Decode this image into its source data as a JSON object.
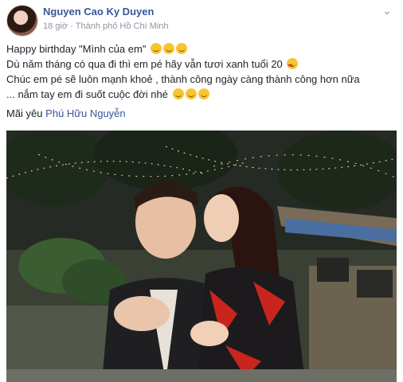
{
  "post": {
    "author": "Nguyen Cao Ky Duyen",
    "time": "18 giờ",
    "separator": "·",
    "location": "Thành phố Hồ Chí Minh",
    "more_icon": "more-options-icon",
    "lines": [
      {
        "text": "Happy birthday \"Mình của em\"",
        "emoji": [
          "grin-icon",
          "grin-icon",
          "grin-icon"
        ]
      },
      {
        "text": "Dù năm tháng có qua đi thì em pé hãy vẫn tươi xanh tuổi 20",
        "emoji": [
          "heart-eyes-icon"
        ]
      },
      {
        "text": "Chúc em pé sẽ luôn mạnh khoẻ , thành công ngày càng thành công hơn nữa",
        "emoji": []
      },
      {
        "text": "... nắm tay em đi suốt cuộc đời nhé",
        "emoji": [
          "smile-icon",
          "smile-icon",
          "smile-icon"
        ]
      }
    ],
    "mention_prefix": "Mãi yêu",
    "mention": "Phú Hữu Nguyễn"
  },
  "photo": {
    "lights_color": "#ffd98a"
  }
}
